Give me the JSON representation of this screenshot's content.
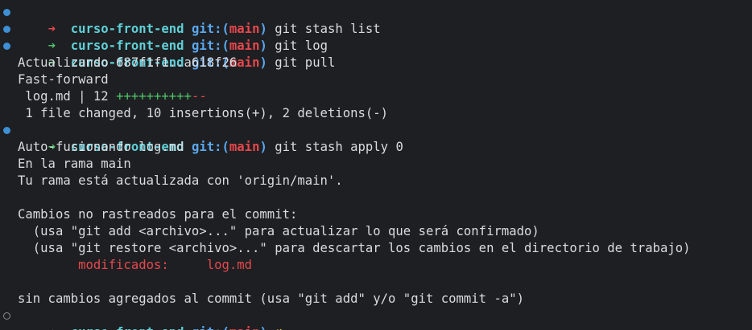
{
  "prompt": {
    "dir": "curso-front-end",
    "git_label": "git:(",
    "branch": "main",
    "close": ")",
    "arrow": "➜",
    "dirty_mark": "✗"
  },
  "commands": {
    "c1": "git stash list",
    "c2": "git log",
    "c3": "git pull",
    "c4": "git stash apply 0"
  },
  "pull_output": {
    "updating": "Actualizando 687f1f1..a618f26",
    "ff": "Fast-forward",
    "file_stat_prefix": " log.md | 12 ",
    "plus_bar": "++++++++++",
    "minus_bar": "--",
    "summary": " 1 file changed, 10 insertions(+), 2 deletions(-)"
  },
  "apply_output": {
    "merge": "Auto-fusionando log.md",
    "on_branch": "En la rama main",
    "up_to_date": "Tu rama está actualizada con 'origin/main'.",
    "not_staged": "Cambios no rastreados para el commit:",
    "hint_add": "  (usa \"git add <archivo>...\" para actualizar lo que será confirmado)",
    "hint_restore": "  (usa \"git restore <archivo>...\" para descartar los cambios en el directorio de trabajo)",
    "modified_label": "        modificados:",
    "modified_file": "     log.md",
    "no_changes": "sin cambios agregados al commit (usa \"git add\" y/o \"git commit -a\")"
  },
  "colors": {
    "background": "#1e1f22",
    "arrow_ok": "#4ec46b",
    "arrow_err": "#e5484d",
    "dir": "#5fd0d8",
    "git_label": "#5aa8ef",
    "branch": "#e5484d",
    "dirty": "#e6c84a",
    "marker": "#3d8fd6"
  }
}
